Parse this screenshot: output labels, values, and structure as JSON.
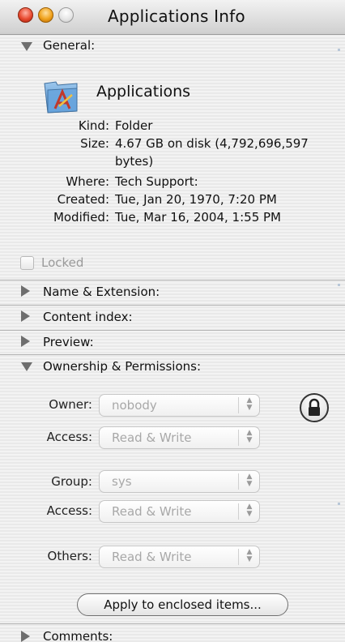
{
  "window": {
    "title": "Applications Info",
    "buttons": [
      "close",
      "minimize",
      "zoom"
    ]
  },
  "general": {
    "header": "General:",
    "name": "Applications",
    "icon": "applications-folder-icon",
    "fields": [
      {
        "key": "Kind:",
        "value": "Folder"
      },
      {
        "key": "Size:",
        "value": "4.67 GB on disk (4,792,696,597",
        "value2": "bytes)"
      },
      {
        "key": "Where:",
        "value": "Tech Support:"
      },
      {
        "key": "Created:",
        "value": "Tue, Jan 20, 1970, 7:20 PM"
      },
      {
        "key": "Modified:",
        "value": "Tue, Mar 16, 2004, 1:55 PM"
      }
    ],
    "locked": {
      "label": "Locked",
      "checked": false
    }
  },
  "sections": {
    "name_extension": "Name & Extension:",
    "content_index": "Content index:",
    "preview": "Preview:",
    "ownership": "Ownership & Permissions:",
    "comments": "Comments:"
  },
  "permissions": {
    "owner": {
      "label": "Owner:",
      "value": "nobody"
    },
    "owner_access": {
      "label": "Access:",
      "value": "Read & Write"
    },
    "group": {
      "label": "Group:",
      "value": "sys"
    },
    "group_access": {
      "label": "Access:",
      "value": "Read & Write"
    },
    "others": {
      "label": "Others:",
      "value": "Read & Write"
    },
    "apply_button": "Apply to enclosed items...",
    "lock_icon": "lock-icon"
  },
  "colors": {
    "disclosure_triangle": "#6e6e6e",
    "disabled_text": "#a8a8a8",
    "close_button": "#e84a2f",
    "minimize_button": "#f0a21c"
  }
}
